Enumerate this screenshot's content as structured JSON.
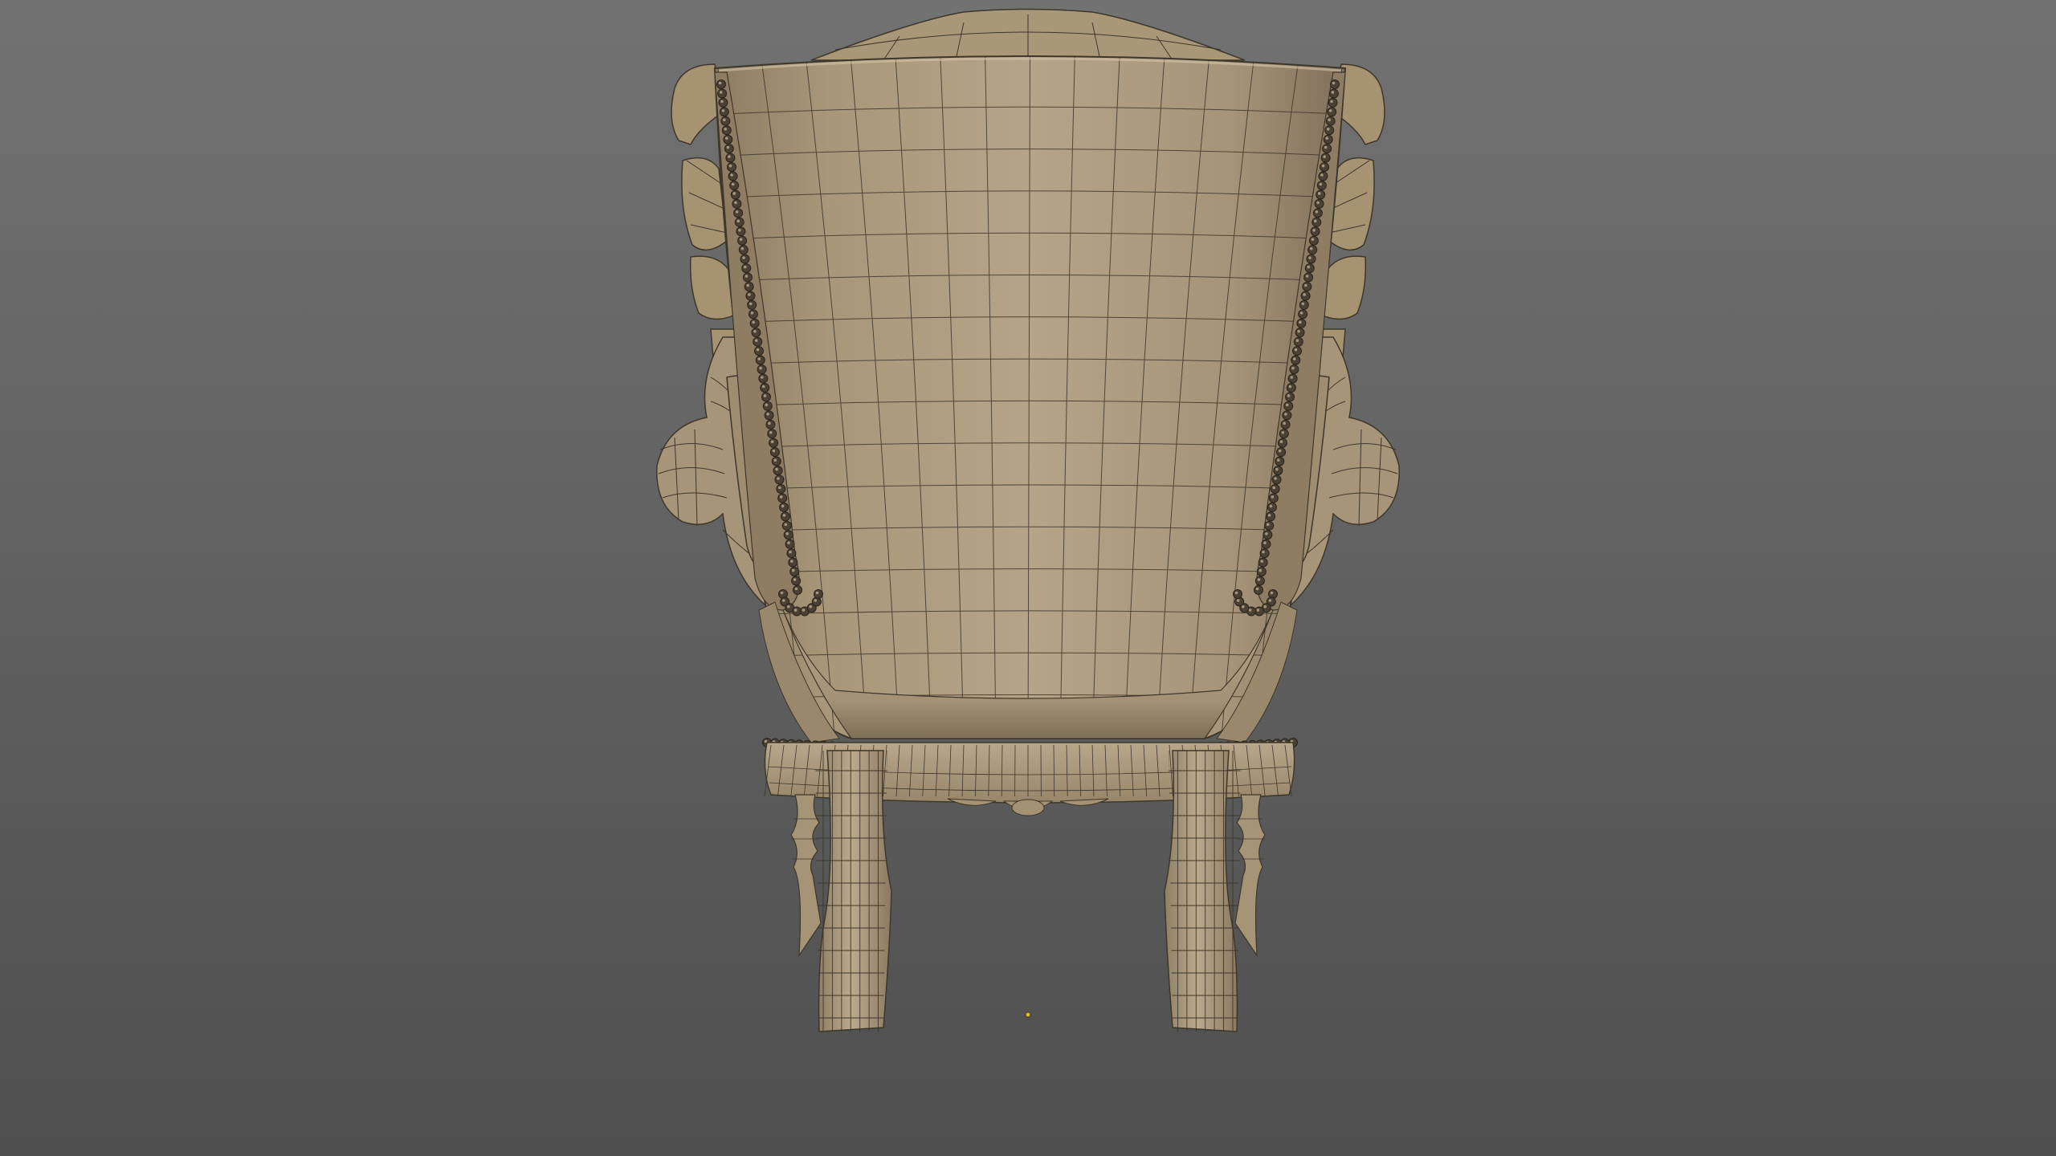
{
  "app": {
    "view": "3d-viewport",
    "background_top": "#727272",
    "background_bottom": "#4f4f4f"
  },
  "model": {
    "subject": "wingback-armchair",
    "view_angle": "back",
    "display": "wireframe-on-shaded",
    "surface_color": "#b3a286",
    "surface_shadow": "#7e6f58",
    "wire_color": "#3e372b",
    "nail_color": "#4a4033"
  },
  "pivot": {
    "color": "#e0c23a"
  }
}
